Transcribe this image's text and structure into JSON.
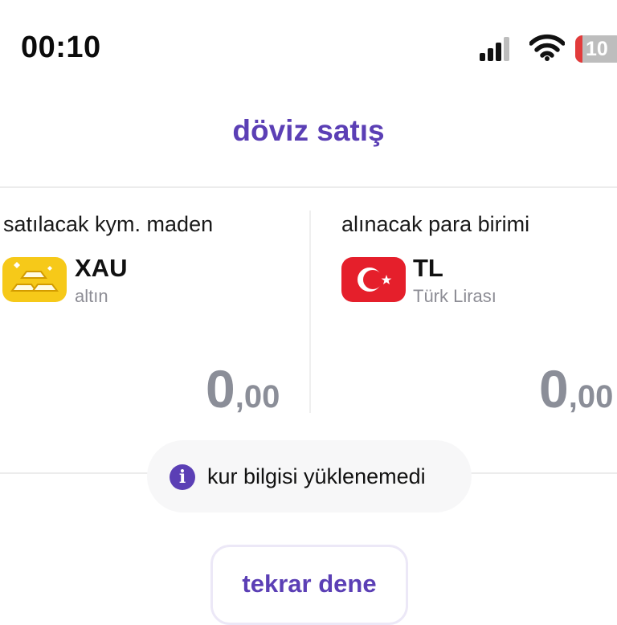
{
  "status_bar": {
    "time": "00:10",
    "battery_level": "10",
    "signal_icon": "cellular-signal-icon",
    "wifi_icon": "wifi-icon",
    "battery_icon": "battery-low-icon"
  },
  "header": {
    "title": "döviz satış"
  },
  "sell_panel": {
    "label": "satılacak kym. maden",
    "code": "XAU",
    "name": "altın",
    "icon": "gold-bars-icon",
    "amount_int": "0",
    "amount_dec": ",00"
  },
  "buy_panel": {
    "label": "alınacak para birimi",
    "code": "TL",
    "name": "Türk Lirası",
    "icon": "turkey-flag-icon",
    "amount_int": "0",
    "amount_dec": ",00"
  },
  "rate_notice": {
    "icon": "info-icon",
    "text": "kur bilgisi yüklenemedi"
  },
  "retry": {
    "label": "tekrar dene"
  },
  "colors": {
    "accent": "#5b3fb5",
    "gold": "#f6c919",
    "flag_red": "#e51f2b",
    "amount_gray": "#8b8e98"
  }
}
